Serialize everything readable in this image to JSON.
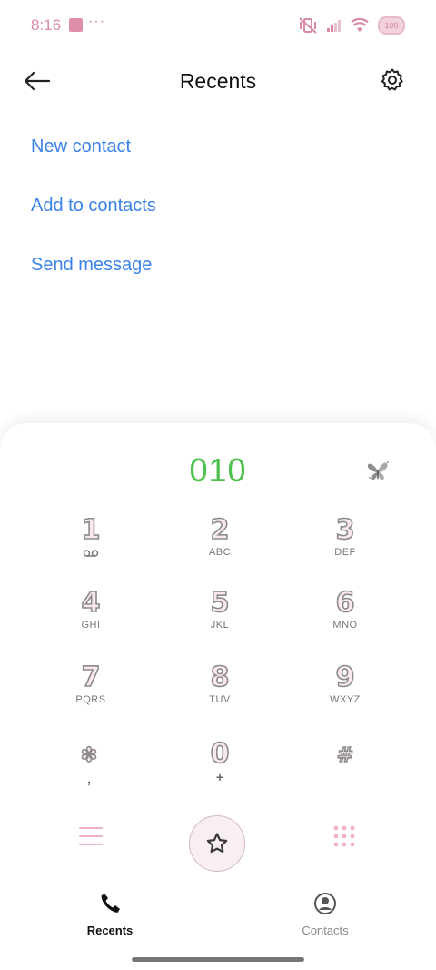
{
  "status_bar": {
    "time": "8:16",
    "dots": "···",
    "battery": "100",
    "accent": "#d98aa0"
  },
  "header": {
    "title": "Recents",
    "back_icon": "arrow-left-icon",
    "settings_icon": "gear-icon"
  },
  "actions": {
    "new_contact": "New contact",
    "add_to_contacts": "Add to contacts",
    "send_message": "Send message",
    "link_color": "#3b82e6"
  },
  "dialer": {
    "entered_number": "010",
    "number_color": "#4cc14c",
    "keys": [
      {
        "digit": "1",
        "sub": ""
      },
      {
        "digit": "2",
        "sub": "ABC"
      },
      {
        "digit": "3",
        "sub": "DEF"
      },
      {
        "digit": "4",
        "sub": "GHI"
      },
      {
        "digit": "5",
        "sub": "JKL"
      },
      {
        "digit": "6",
        "sub": "MNO"
      },
      {
        "digit": "7",
        "sub": "PQRS"
      },
      {
        "digit": "8",
        "sub": "TUV"
      },
      {
        "digit": "9",
        "sub": "WXYZ"
      },
      {
        "digit": "✽",
        "sub": ","
      },
      {
        "digit": "0",
        "sub": "+"
      },
      {
        "digit": "#",
        "sub": ""
      }
    ]
  },
  "bottom_nav": {
    "recents": "Recents",
    "contacts": "Contacts"
  }
}
